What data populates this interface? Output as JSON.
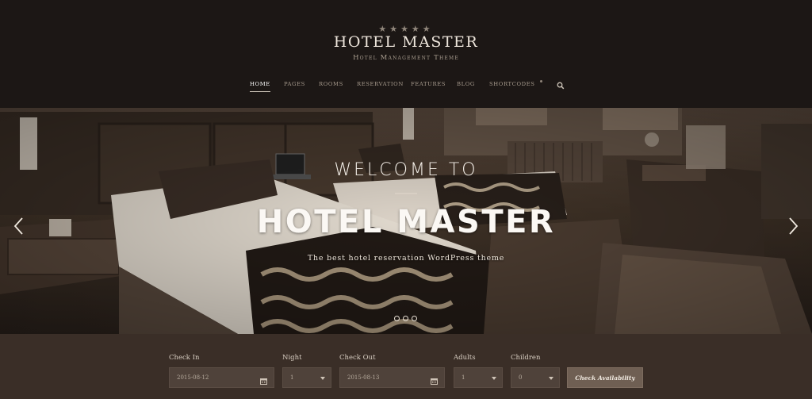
{
  "header": {
    "stars": "★★★★★",
    "brand_name": "HOTEL MASTER",
    "brand_tagline": "Hotel Management Theme",
    "nav": [
      {
        "label": "HOME",
        "active": true
      },
      {
        "label": "PAGES"
      },
      {
        "label": "ROOMS"
      },
      {
        "label": "RESERVATION"
      },
      {
        "label": "FEATURES"
      },
      {
        "label": "BLOG"
      },
      {
        "label": "SHORTCODES"
      }
    ],
    "search_icon": "search-icon"
  },
  "hero": {
    "welcome": "WELCOME TO",
    "title": "HOTEL MASTER",
    "subtitle": "The best hotel reservation WordPress theme",
    "slide_count": 3,
    "active_slide": 1,
    "prev_icon": "chevron-left-icon",
    "next_icon": "chevron-right-icon"
  },
  "booking": {
    "check_in": {
      "label": "Check In",
      "value": "2015-08-12",
      "icon": "calendar-icon"
    },
    "night": {
      "label": "Night",
      "value": "1",
      "icon": "caret-down-icon"
    },
    "check_out": {
      "label": "Check Out",
      "value": "2015-08-13",
      "icon": "calendar-icon"
    },
    "adults": {
      "label": "Adults",
      "value": "1",
      "icon": "caret-down-icon"
    },
    "children": {
      "label": "Children",
      "value": "0",
      "icon": "caret-down-icon"
    },
    "button_label": "Check Availability"
  },
  "colors": {
    "header_bg": "#1c1715",
    "booking_bg": "#3a2e27",
    "field_bg": "#4f423a",
    "button_bg": "#6f5f53",
    "text_light": "#f4efe8"
  }
}
